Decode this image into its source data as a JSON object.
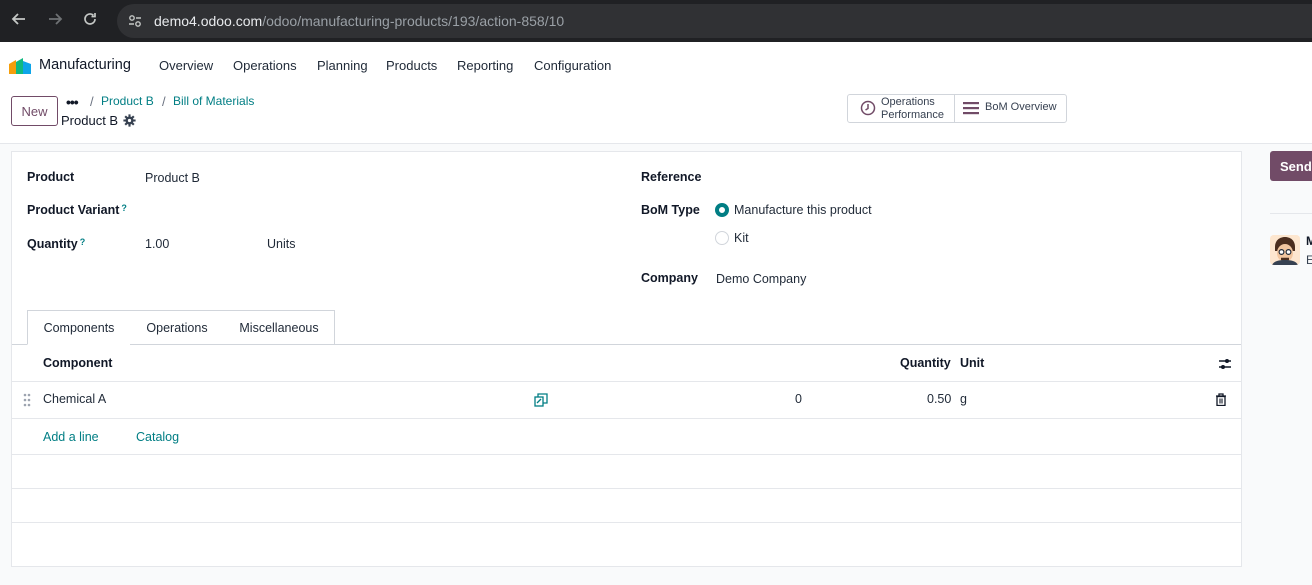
{
  "browser": {
    "url_domain": "demo4.odoo.com",
    "url_path": "/odoo/manufacturing-products/193/action-858/10"
  },
  "app": {
    "name": "Manufacturing",
    "menu": [
      "Overview",
      "Operations",
      "Planning",
      "Products",
      "Reporting",
      "Configuration"
    ]
  },
  "control": {
    "new_label": "New",
    "breadcrumbs": [
      "Product B",
      "Bill of Materials"
    ],
    "record_title": "Product B",
    "stat_buttons": {
      "operations_performance_line1": "Operations",
      "operations_performance_line2": "Performance",
      "bom_overview": "BoM Overview"
    }
  },
  "form": {
    "product_label": "Product",
    "product_value": "Product B",
    "variant_label": "Product Variant",
    "quantity_label": "Quantity",
    "quantity_value": "1.00",
    "quantity_unit": "Units",
    "help_mark": "?",
    "reference_label": "Reference",
    "bom_type_label": "BoM Type",
    "bom_type_options": [
      "Manufacture this product",
      "Kit"
    ],
    "bom_type_selected": "Manufacture this product",
    "company_label": "Company",
    "company_value": "Demo Company"
  },
  "tabs": [
    {
      "label": "Components",
      "active": true
    },
    {
      "label": "Operations",
      "active": false
    },
    {
      "label": "Miscellaneous",
      "active": false
    }
  ],
  "table": {
    "headers": {
      "component": "Component",
      "quantity": "Quantity",
      "unit": "Unit"
    },
    "rows": [
      {
        "component": "Chemical A",
        "on_hand": "0",
        "quantity": "0.50",
        "unit": "g"
      }
    ],
    "add_line": "Add a line",
    "catalog": "Catalog"
  },
  "chatter": {
    "send_label": "Send",
    "line1": "M",
    "line2": "E"
  },
  "colors": {
    "brand": "#714b67",
    "accent": "#017e84"
  }
}
